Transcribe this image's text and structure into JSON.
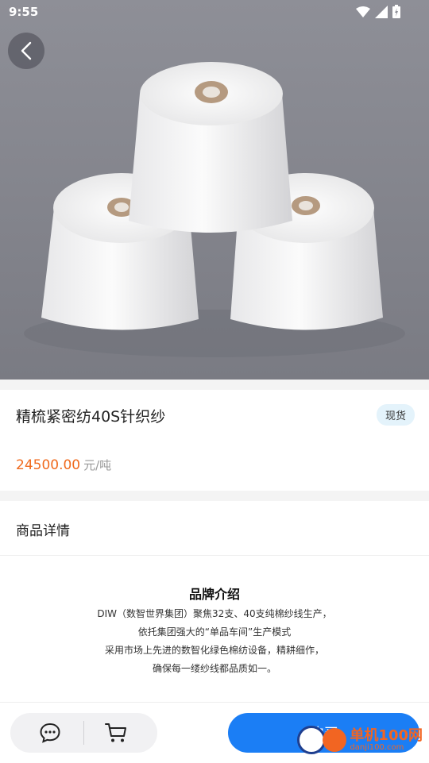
{
  "status_bar": {
    "time": "9:55"
  },
  "product": {
    "title": "精梳紧密纺40S针织纱",
    "stock_badge": "现货",
    "price": "24500.00",
    "price_unit": "元/吨"
  },
  "details": {
    "label": "商品详情"
  },
  "brand_intro": {
    "heading": "品牌介绍",
    "lines": [
      "DIW（数智世界集团）聚焦32支、40支纯棉纱线生产，",
      "依托集团强大的“单品车间”生产模式",
      "采用市场上先进的数智化绿色棉纺设备，精耕细作，",
      "确保每一缕纱线都品质如一。"
    ]
  },
  "bottom_bar": {
    "buy_label": "购买"
  },
  "watermark": {
    "brand": "单机100网",
    "domain": "danji100.com"
  },
  "icons": {
    "back": "chevron-left-icon",
    "chat": "chat-bubble-icon",
    "cart": "shopping-cart-icon"
  },
  "colors": {
    "price": "#f06a1d",
    "buy_button": "#1b7ef5",
    "badge_bg": "#e4f3fb"
  }
}
